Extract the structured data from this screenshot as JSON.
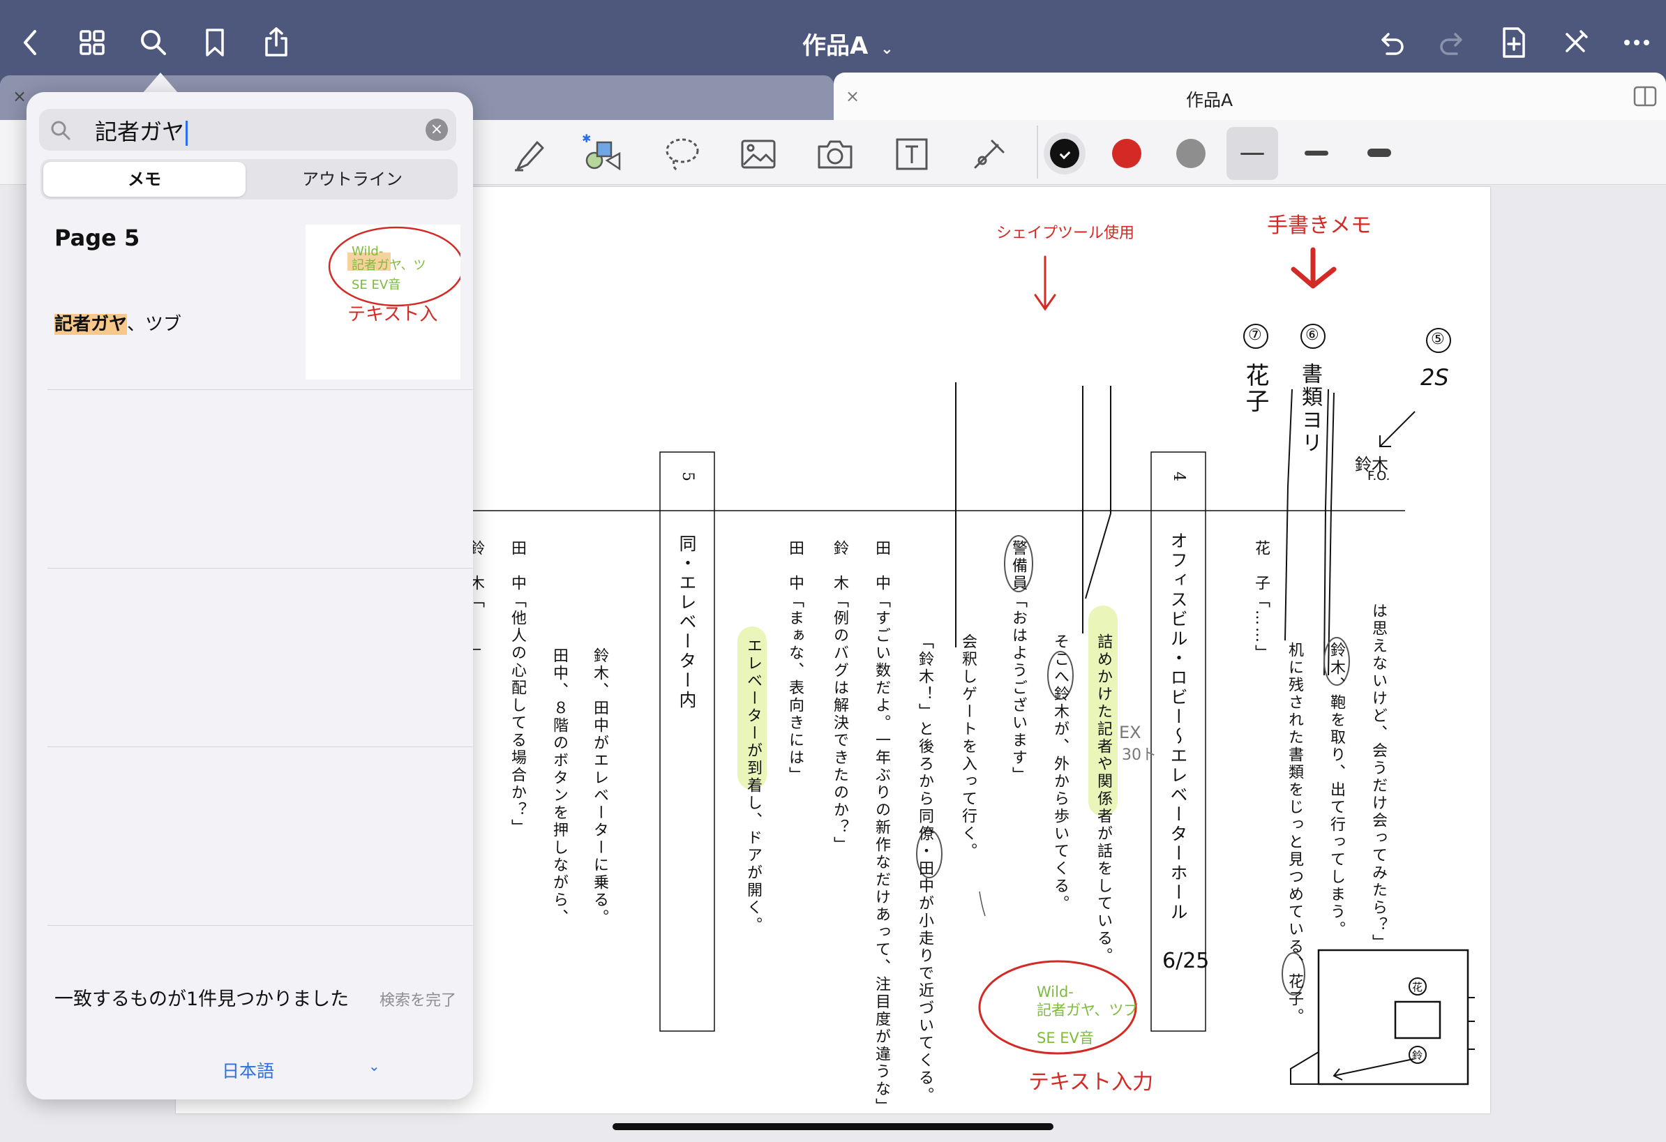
{
  "nav": {
    "title": "作品A",
    "icons": [
      "back-icon",
      "grid-icon",
      "search-icon",
      "bookmark-icon",
      "share-icon",
      "undo-icon",
      "redo-icon",
      "add-page-icon",
      "close-edit-icon",
      "more-icon"
    ]
  },
  "tabs": {
    "left_close": "×",
    "right_close": "×",
    "right_title": "作品A"
  },
  "toolbar": {
    "colors": [
      "#111111",
      "#d42a25",
      "#8e8e8e"
    ],
    "tools": [
      "highlighter-icon",
      "shape-tool-icon",
      "lasso-icon",
      "image-icon",
      "camera-icon",
      "text-tool-icon",
      "laser-pointer-icon"
    ]
  },
  "search": {
    "query": "記者ガヤ",
    "tab_memo": "メモ",
    "tab_outline": "アウトライン",
    "result_page": "Page 5",
    "snippet_match": "記者ガヤ",
    "snippet_rest": "、ツブ",
    "thumb_line1": "Wild-",
    "thumb_line2": "記者ガヤ、ツ",
    "thumb_line3": "SE EV音",
    "thumb_red": "テキスト入",
    "found_msg": "一致するものが1件見つかりました",
    "done": "検索を完了",
    "language": "日本語",
    "language_chevron": "⌄"
  },
  "script_page": {
    "scene5_num": "5",
    "scene5_heading": "同・エレベーター内",
    "scene4_num": "4",
    "scene4_heading": "オフィスビル・ロビー〜エレベーターホール",
    "cols": [
      "鈴　木「……」",
      "田　中「他人の心配してる場合か？」",
      "鈴木、田中がエレベーターに乗る。",
      "田中、８階のボタンを押しながら、",
      "エレベーターが到着し、ドアが開く。",
      "田　中「まぁな、表向きには」",
      "鈴　木「例のバグは解決できたのか？」",
      "田　中「すごい数だよ。一年ぶりの新作なだけあって、注目度が違うな」",
      "「鈴木！」と後ろから同僚・田中が小走りで近づいてくる。",
      "会釈しゲートを入って行く。",
      "警備員「おはようございます」",
      "そこへ鈴木が、外から歩いてくる。",
      "詰めかけた記者や関係者が話をしている。",
      "花　子「……」",
      "机に残された書類をじっと見つめている、花子。",
      "鈴木、鞄を取り、出て行ってしまう。",
      "は思えないけど、会うだけ会ってみたら？」"
    ],
    "annotations": {
      "shape_tool": "シェイプツール使用",
      "handwritten_memo": "手書きメモ",
      "text_input": "テキスト入力",
      "wild_line1": "Wild-",
      "wild_line2": "記者ガヤ、ツブ",
      "wild_line3": "SE EV音",
      "num7": "⑦",
      "num6": "⑥",
      "num5": "⑤",
      "hanako": "花子",
      "shorui": "書類ヨリ",
      "two_s": "2S",
      "suzuki_fo": "鈴木",
      "fo": "F.O.",
      "ex": "EX",
      "ex30": "30ト",
      "date": "6/25",
      "mark_hana": "花",
      "mark_suzu": "鈴"
    }
  }
}
